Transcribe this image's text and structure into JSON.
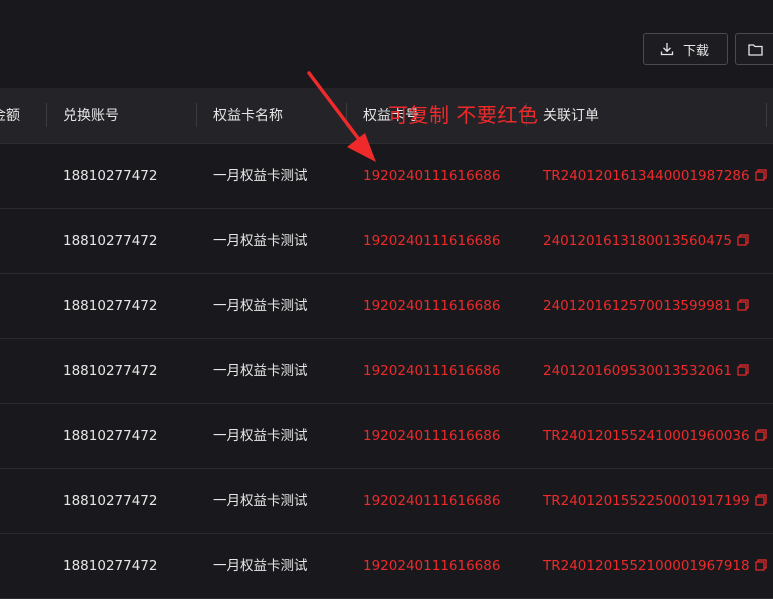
{
  "toolbar": {
    "download_label": "下载"
  },
  "table": {
    "columns": [
      "金额",
      "兑换账号",
      "权益卡名称",
      "权益卡号",
      "关联订单"
    ],
    "rows": [
      {
        "account": "18810277472",
        "card_name": "一月权益卡测试",
        "card_no": "1920240111616686",
        "order": "TR2401201613440001987286"
      },
      {
        "account": "18810277472",
        "card_name": "一月权益卡测试",
        "card_no": "1920240111616686",
        "order": "2401201613180013560475"
      },
      {
        "account": "18810277472",
        "card_name": "一月权益卡测试",
        "card_no": "1920240111616686",
        "order": "2401201612570013599981"
      },
      {
        "account": "18810277472",
        "card_name": "一月权益卡测试",
        "card_no": "1920240111616686",
        "order": "2401201609530013532061"
      },
      {
        "account": "18810277472",
        "card_name": "一月权益卡测试",
        "card_no": "1920240111616686",
        "order": "TR2401201552410001960036"
      },
      {
        "account": "18810277472",
        "card_name": "一月权益卡测试",
        "card_no": "1920240111616686",
        "order": "TR2401201552250001917199"
      },
      {
        "account": "18810277472",
        "card_name": "一月权益卡测试",
        "card_no": "1920240111616686",
        "order": "TR2401201552100001967918"
      }
    ]
  },
  "annotation": {
    "text": "可复制  不要红色"
  },
  "colors": {
    "background": "#19191d",
    "header_bg": "#232328",
    "highlight_red": "#ee2a2a"
  },
  "icons": {
    "download": "download-icon",
    "folder": "folder-icon",
    "copy": "copy-icon"
  }
}
